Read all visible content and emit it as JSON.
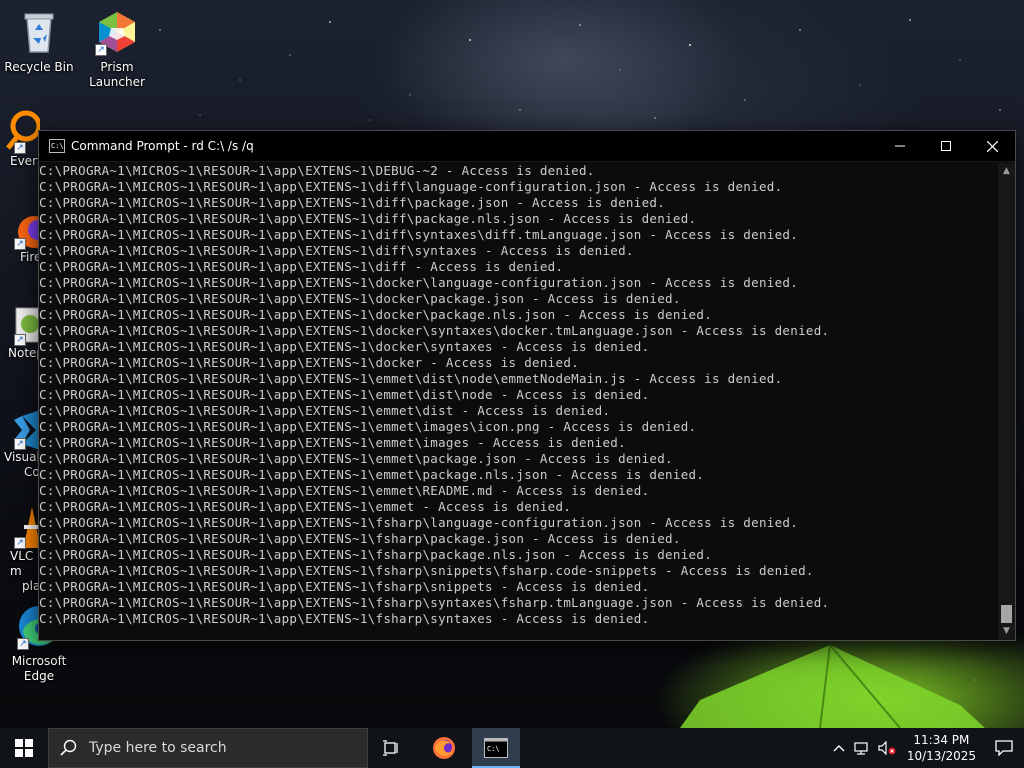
{
  "desktop": {
    "icons": [
      {
        "label": "Recycle Bin"
      },
      {
        "label": "Prism Launcher"
      },
      {
        "label": "Every"
      },
      {
        "label": "Fire"
      },
      {
        "label": "Notep"
      },
      {
        "label": "Visual"
      },
      {
        "label": "Co"
      },
      {
        "label": "VLC m"
      },
      {
        "label": "pla"
      },
      {
        "label": "Microsoft Edge"
      }
    ]
  },
  "window": {
    "title": "Command Prompt - rd  C:\\ /s /q",
    "lines": [
      "C:\\PROGRA~1\\MICROS~1\\RESOUR~1\\app\\EXTENS~1\\DEBUG-~2 - Access is denied.",
      "C:\\PROGRA~1\\MICROS~1\\RESOUR~1\\app\\EXTENS~1\\diff\\language-configuration.json - Access is denied.",
      "C:\\PROGRA~1\\MICROS~1\\RESOUR~1\\app\\EXTENS~1\\diff\\package.json - Access is denied.",
      "C:\\PROGRA~1\\MICROS~1\\RESOUR~1\\app\\EXTENS~1\\diff\\package.nls.json - Access is denied.",
      "C:\\PROGRA~1\\MICROS~1\\RESOUR~1\\app\\EXTENS~1\\diff\\syntaxes\\diff.tmLanguage.json - Access is denied.",
      "C:\\PROGRA~1\\MICROS~1\\RESOUR~1\\app\\EXTENS~1\\diff\\syntaxes - Access is denied.",
      "C:\\PROGRA~1\\MICROS~1\\RESOUR~1\\app\\EXTENS~1\\diff - Access is denied.",
      "C:\\PROGRA~1\\MICROS~1\\RESOUR~1\\app\\EXTENS~1\\docker\\language-configuration.json - Access is denied.",
      "C:\\PROGRA~1\\MICROS~1\\RESOUR~1\\app\\EXTENS~1\\docker\\package.json - Access is denied.",
      "C:\\PROGRA~1\\MICROS~1\\RESOUR~1\\app\\EXTENS~1\\docker\\package.nls.json - Access is denied.",
      "C:\\PROGRA~1\\MICROS~1\\RESOUR~1\\app\\EXTENS~1\\docker\\syntaxes\\docker.tmLanguage.json - Access is denied.",
      "C:\\PROGRA~1\\MICROS~1\\RESOUR~1\\app\\EXTENS~1\\docker\\syntaxes - Access is denied.",
      "C:\\PROGRA~1\\MICROS~1\\RESOUR~1\\app\\EXTENS~1\\docker - Access is denied.",
      "C:\\PROGRA~1\\MICROS~1\\RESOUR~1\\app\\EXTENS~1\\emmet\\dist\\node\\emmetNodeMain.js - Access is denied.",
      "C:\\PROGRA~1\\MICROS~1\\RESOUR~1\\app\\EXTENS~1\\emmet\\dist\\node - Access is denied.",
      "C:\\PROGRA~1\\MICROS~1\\RESOUR~1\\app\\EXTENS~1\\emmet\\dist - Access is denied.",
      "C:\\PROGRA~1\\MICROS~1\\RESOUR~1\\app\\EXTENS~1\\emmet\\images\\icon.png - Access is denied.",
      "C:\\PROGRA~1\\MICROS~1\\RESOUR~1\\app\\EXTENS~1\\emmet\\images - Access is denied.",
      "C:\\PROGRA~1\\MICROS~1\\RESOUR~1\\app\\EXTENS~1\\emmet\\package.json - Access is denied.",
      "C:\\PROGRA~1\\MICROS~1\\RESOUR~1\\app\\EXTENS~1\\emmet\\package.nls.json - Access is denied.",
      "C:\\PROGRA~1\\MICROS~1\\RESOUR~1\\app\\EXTENS~1\\emmet\\README.md - Access is denied.",
      "C:\\PROGRA~1\\MICROS~1\\RESOUR~1\\app\\EXTENS~1\\emmet - Access is denied.",
      "C:\\PROGRA~1\\MICROS~1\\RESOUR~1\\app\\EXTENS~1\\fsharp\\language-configuration.json - Access is denied.",
      "C:\\PROGRA~1\\MICROS~1\\RESOUR~1\\app\\EXTENS~1\\fsharp\\package.json - Access is denied.",
      "C:\\PROGRA~1\\MICROS~1\\RESOUR~1\\app\\EXTENS~1\\fsharp\\package.nls.json - Access is denied.",
      "C:\\PROGRA~1\\MICROS~1\\RESOUR~1\\app\\EXTENS~1\\fsharp\\snippets\\fsharp.code-snippets - Access is denied.",
      "C:\\PROGRA~1\\MICROS~1\\RESOUR~1\\app\\EXTENS~1\\fsharp\\snippets - Access is denied.",
      "C:\\PROGRA~1\\MICROS~1\\RESOUR~1\\app\\EXTENS~1\\fsharp\\syntaxes\\fsharp.tmLanguage.json - Access is denied.",
      "C:\\PROGRA~1\\MICROS~1\\RESOUR~1\\app\\EXTENS~1\\fsharp\\syntaxes - Access is denied."
    ]
  },
  "taskbar": {
    "search_placeholder": "Type here to search",
    "time": "11:34 PM",
    "date": "10/13/2025"
  },
  "colors": {
    "console_bg": "#0c0c0c",
    "console_text": "#cccccc",
    "taskbar_bg": "#101418",
    "active_indicator": "#6eb3ff"
  }
}
